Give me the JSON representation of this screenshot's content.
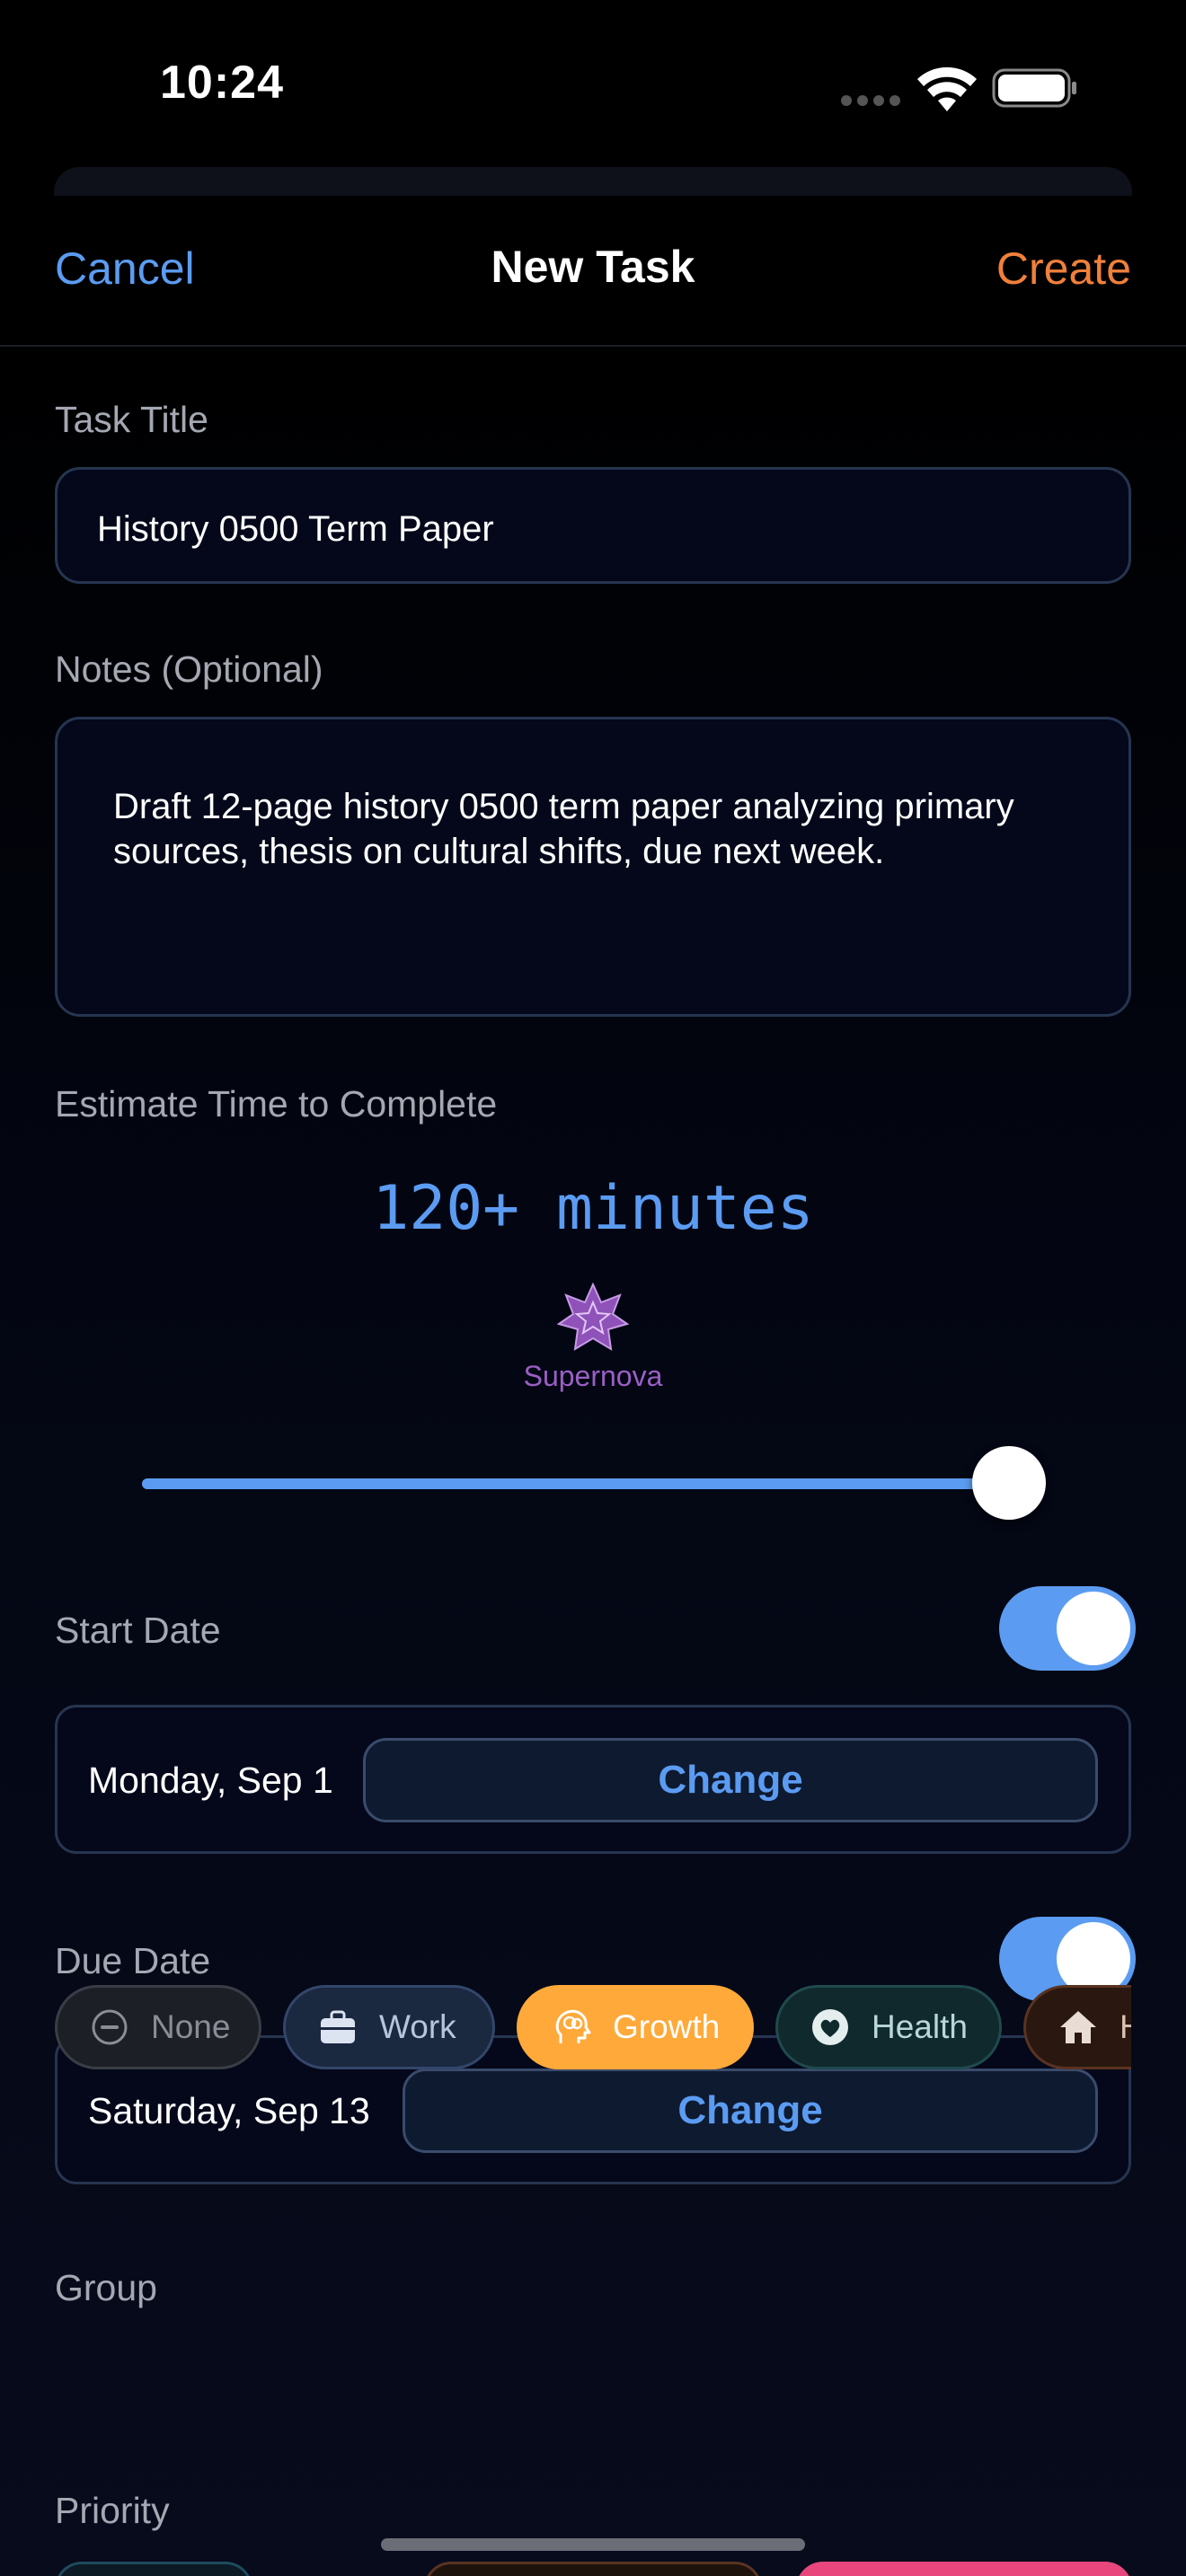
{
  "status_bar": {
    "time": "10:24"
  },
  "nav": {
    "cancel_label": "Cancel",
    "title": "New Task",
    "create_label": "Create"
  },
  "form": {
    "title_label": "Task Title",
    "title_value": "History 0500 Term Paper",
    "notes_label": "Notes (Optional)",
    "notes_value": "Draft 12-page history 0500 term paper analyzing primary sources, thesis on cultural shifts, due next week.",
    "estimate_label": "Estimate Time to Complete",
    "estimate_value": "120+ minutes",
    "estimate_tier": "Supernova",
    "estimate_slider_level": 1.0,
    "start_date": {
      "label": "Start Date",
      "enabled": true,
      "value": "Monday, Sep 1",
      "change_label": "Change"
    },
    "due_date": {
      "label": "Due Date",
      "enabled": true,
      "value": "Saturday, Sep 13",
      "change_label": "Change"
    },
    "group": {
      "label": "Group",
      "selected": "Growth",
      "options": [
        {
          "label": "None",
          "icon": "minus-circle-icon"
        },
        {
          "label": "Work",
          "icon": "briefcase-icon"
        },
        {
          "label": "Growth",
          "icon": "brain-head-icon"
        },
        {
          "label": "Health",
          "icon": "heart-circle-icon"
        },
        {
          "label": "H",
          "icon": "house-icon"
        }
      ]
    },
    "priority_label": "Priority"
  },
  "colors": {
    "accent": "#5b9cf2",
    "create": "#f0803a",
    "growth": "#ffa93a",
    "supernova": "#9a5fc4",
    "priority_pink": "#e8467c"
  }
}
